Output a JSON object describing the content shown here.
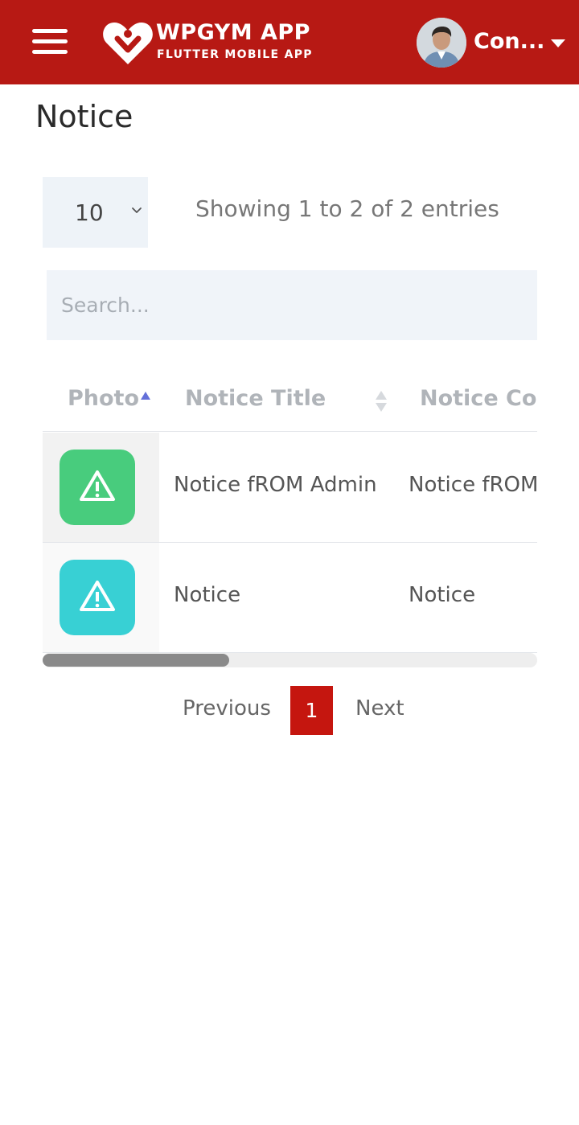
{
  "header": {
    "app_title": "WPGYM APP",
    "app_subtitle": "FLUTTER MOBILE APP",
    "user_name": "Con...",
    "brand_color": "#b71914",
    "icons": {
      "menu": "hamburger-icon",
      "logo": "heart-logo-icon",
      "dropdown": "caret-down-icon"
    }
  },
  "page": {
    "title": "Notice"
  },
  "controls": {
    "length_value": "10",
    "info": "Showing 1 to 2 of 2 entries",
    "search_placeholder": "Search..."
  },
  "table": {
    "columns": [
      "Photo",
      "Notice Title",
      "Notice Con"
    ],
    "sorted_column": "Photo",
    "rows": [
      {
        "icon_color": "#48cc7d",
        "title": "Notice fROM Admin",
        "content": "Notice fROM"
      },
      {
        "icon_color": "#38d0d4",
        "title": "Notice",
        "content": "Notice"
      }
    ]
  },
  "pagination": {
    "previous": "Previous",
    "current": "1",
    "next": "Next",
    "active_color": "#c5160f"
  }
}
